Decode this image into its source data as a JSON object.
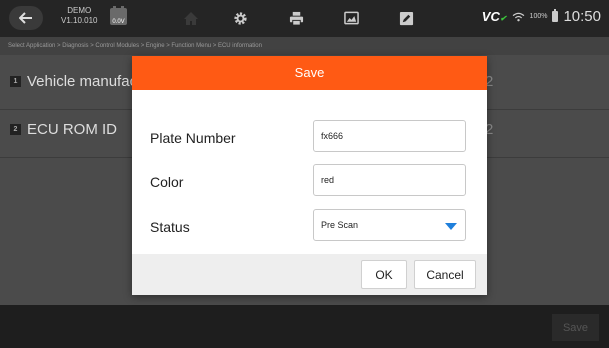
{
  "topbar": {
    "demo": "DEMO",
    "version": "V1.10.010",
    "voltage": "0.0V",
    "vc_text": "VC",
    "battery_pct": "100%",
    "time": "10:50"
  },
  "breadcrumb": "Select Application > Diagnosis > Control Modules > Engine > Function Menu > ECU information",
  "rows": [
    {
      "num": "1",
      "label": "Vehicle manufact",
      "value": "2"
    },
    {
      "num": "2",
      "label": "ECU ROM ID",
      "value": "2"
    }
  ],
  "bottombar": {
    "save_label": "Save"
  },
  "dialog": {
    "title": "Save",
    "plate_label": "Plate Number",
    "plate_value": "fx666",
    "color_label": "Color",
    "color_value": "red",
    "status_label": "Status",
    "status_value": "Pre Scan",
    "ok_label": "OK",
    "cancel_label": "Cancel"
  },
  "colors": {
    "accent": "#ff5a14",
    "dropdown_caret": "#1f7fdb",
    "vc_badge": "#3cc43c"
  }
}
